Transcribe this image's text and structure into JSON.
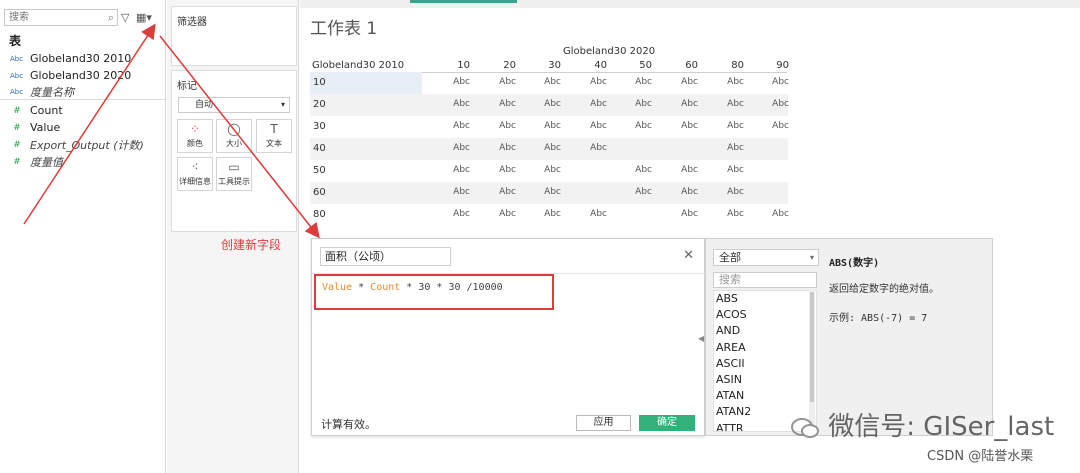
{
  "data_pane": {
    "search_placeholder": "搜索",
    "tables_header": "表",
    "dimensions": [
      {
        "label": "Globeland30 2010"
      },
      {
        "label": "Globeland30 2020"
      },
      {
        "label": "度量名称"
      }
    ],
    "measures": [
      {
        "label": "Count"
      },
      {
        "label": "Value"
      },
      {
        "label": "Export_Output (计数)"
      },
      {
        "label": "度量值"
      }
    ]
  },
  "filters": {
    "title": "筛选器"
  },
  "marks": {
    "title": "标记",
    "mark_type": "自动",
    "buttons": [
      {
        "label": "颜色",
        "icon": "color-icon"
      },
      {
        "label": "大小",
        "icon": "size-icon"
      },
      {
        "label": "文本",
        "icon": "text-icon"
      },
      {
        "label": "详细信息",
        "icon": "detail-icon"
      },
      {
        "label": "工具提示",
        "icon": "tooltip-icon"
      }
    ]
  },
  "worksheet": {
    "title": "工作表 1",
    "column_header": "Globeland30 2020",
    "row_header": "Globeland30 2010",
    "columns": [
      "10",
      "20",
      "30",
      "40",
      "50",
      "60",
      "80",
      "90"
    ],
    "rows": [
      {
        "label": "10",
        "cells": [
          "Abc",
          "Abc",
          "Abc",
          "Abc",
          "Abc",
          "Abc",
          "Abc",
          "Abc"
        ]
      },
      {
        "label": "20",
        "cells": [
          "Abc",
          "Abc",
          "Abc",
          "Abc",
          "Abc",
          "Abc",
          "Abc",
          "Abc"
        ]
      },
      {
        "label": "30",
        "cells": [
          "Abc",
          "Abc",
          "Abc",
          "Abc",
          "Abc",
          "Abc",
          "Abc",
          "Abc"
        ]
      },
      {
        "label": "40",
        "cells": [
          "Abc",
          "Abc",
          "Abc",
          "Abc",
          "",
          "",
          "Abc",
          ""
        ]
      },
      {
        "label": "50",
        "cells": [
          "Abc",
          "Abc",
          "Abc",
          "",
          "Abc",
          "Abc",
          "Abc",
          ""
        ]
      },
      {
        "label": "60",
        "cells": [
          "Abc",
          "Abc",
          "Abc",
          "",
          "Abc",
          "Abc",
          "Abc",
          ""
        ]
      },
      {
        "label": "80",
        "cells": [
          "Abc",
          "Abc",
          "Abc",
          "Abc",
          "",
          "Abc",
          "Abc",
          "Abc"
        ]
      }
    ]
  },
  "calc_dialog": {
    "name": "面积（公顷）",
    "formula": {
      "field1": "Value",
      "op1": " * ",
      "field2": "Count",
      "rest": " * 30 * 30 /10000"
    },
    "status": "计算有效。",
    "apply_label": "应用",
    "ok_label": "确定"
  },
  "function_panel": {
    "category": "全部",
    "search_placeholder": "搜索",
    "functions": [
      "ABS",
      "ACOS",
      "AND",
      "AREA",
      "ASCII",
      "ASIN",
      "ATAN",
      "ATAN2",
      "ATTR"
    ],
    "selected_name": "ABS(数字)",
    "description": "返回给定数字的绝对值。",
    "example": "示例: ABS(-7) = 7"
  },
  "annotations": {
    "new_field": "创建新字段",
    "watermark": "微信号: GISer_last",
    "credit": "CSDN @陆誉水栗",
    "accent_color": "#e03b3b"
  }
}
